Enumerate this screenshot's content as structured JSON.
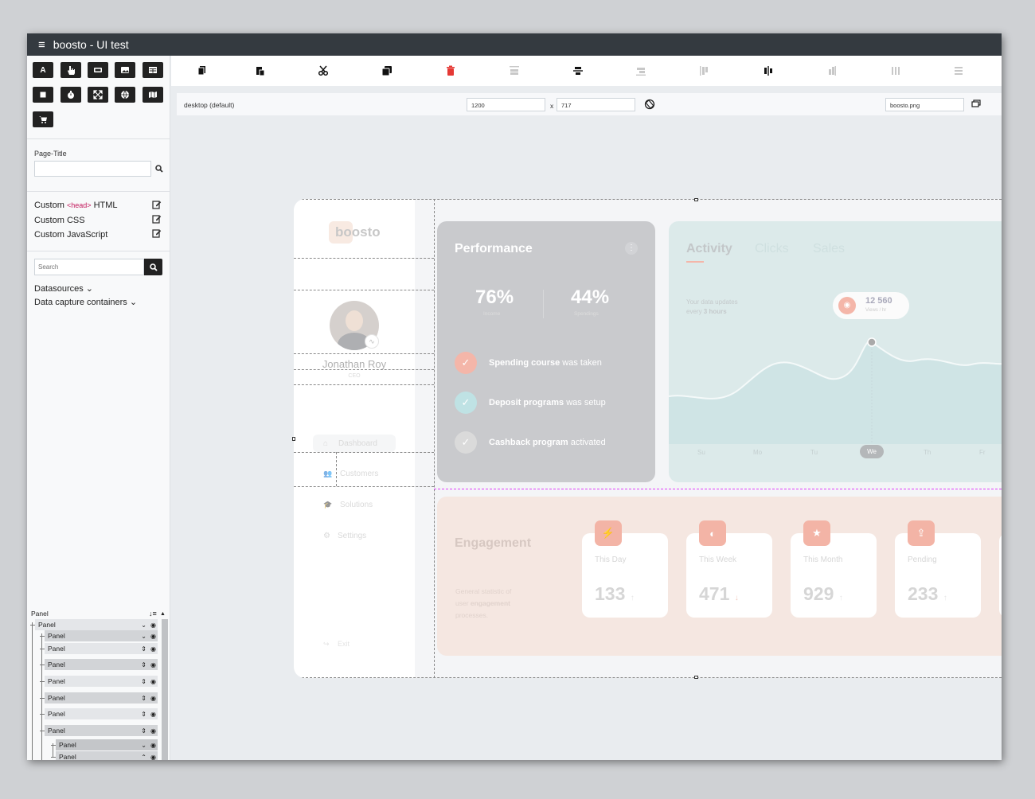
{
  "app": {
    "title": "boosto - UI test"
  },
  "sidebar": {
    "page_title_label": "Page-Title",
    "page_title_value": "",
    "custom": [
      {
        "tag": "",
        "label": "Custom",
        "suffix": "HTML",
        "tag_text": "<head>"
      },
      {
        "label": "Custom CSS"
      },
      {
        "label": "Custom JavaScript"
      }
    ],
    "search_placeholder": "Search",
    "datasources": "Datasources ⌄",
    "data_capture": "Data capture containers ⌄",
    "tree_header": "Panel",
    "tree": [
      "Panel",
      "Panel",
      "Panel",
      "Panel",
      "Panel",
      "Panel",
      "Panel",
      "Panel",
      "Panel",
      "Panel",
      "Panel"
    ]
  },
  "subbar": {
    "device": "desktop (default)",
    "width": "1200",
    "x": "x",
    "height": "717",
    "filename": "boosto.png"
  },
  "preview": {
    "logo": "boosto",
    "user_name": "Jonathan Roy",
    "user_role": "CEO",
    "nav": [
      "Dashboard",
      "Customers",
      "Solutions",
      "Settings"
    ],
    "exit": "Exit",
    "performance": {
      "title": "Performance",
      "stat1_value": "76%",
      "stat1_label": "Income",
      "stat2_value": "44%",
      "stat2_label": "Spendings",
      "items": [
        {
          "bold": "Spending course",
          "rest": " was taken"
        },
        {
          "bold": "Deposit programs",
          "rest": " was setup"
        },
        {
          "bold": "Cashback program",
          "rest": " activated"
        }
      ]
    },
    "activity": {
      "tabs": [
        "Activity",
        "Clicks",
        "Sales"
      ],
      "note_line1": "Your data updates",
      "note_line2_pre": "every ",
      "note_line2_bold": "3 hours",
      "badge_value": "12 560",
      "badge_label": "Views / hr",
      "days": [
        "Su",
        "Mo",
        "Tu",
        "We",
        "Th",
        "Fr"
      ]
    },
    "engagement": {
      "title": "Engagement",
      "desc1": "General statistic of",
      "desc2_pre": "user ",
      "desc2_bold": "engagement",
      "desc3": "processes.",
      "cards": [
        {
          "label": "This Day",
          "value": "133",
          "arrow": "↑"
        },
        {
          "label": "This Week",
          "value": "471",
          "arrow": "↓"
        },
        {
          "label": "This Month",
          "value": "929",
          "arrow": "↑"
        },
        {
          "label": "Pending",
          "value": "233",
          "arrow": "↑"
        }
      ]
    }
  },
  "colors": {
    "titlebar": "#343a40",
    "accent_red": "#e53935",
    "salmon": "#f3b4a6",
    "teal": "#a8dcdc"
  }
}
